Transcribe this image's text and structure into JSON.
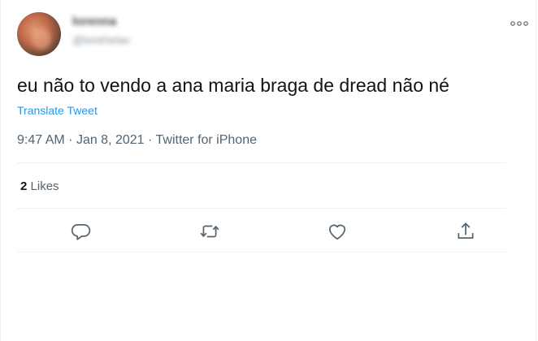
{
  "author": {
    "display_name": "lorenna",
    "handle": "@lorehelax"
  },
  "tweet": {
    "text": "eu não to vendo a ana maria braga de dread não né",
    "translate_label": "Translate Tweet",
    "time": "9:47 AM",
    "date": "Jan 8, 2021",
    "source": "Twitter for iPhone",
    "separator": "·"
  },
  "stats": {
    "likes_count": "2",
    "likes_label": "Likes"
  },
  "icons": {
    "more": "more-dots-icon",
    "reply": "reply-icon",
    "retweet": "retweet-icon",
    "like": "heart-icon",
    "share": "share-icon"
  },
  "colors": {
    "accent": "#1d9bf0",
    "muted": "#536471",
    "text": "#0f1419"
  }
}
